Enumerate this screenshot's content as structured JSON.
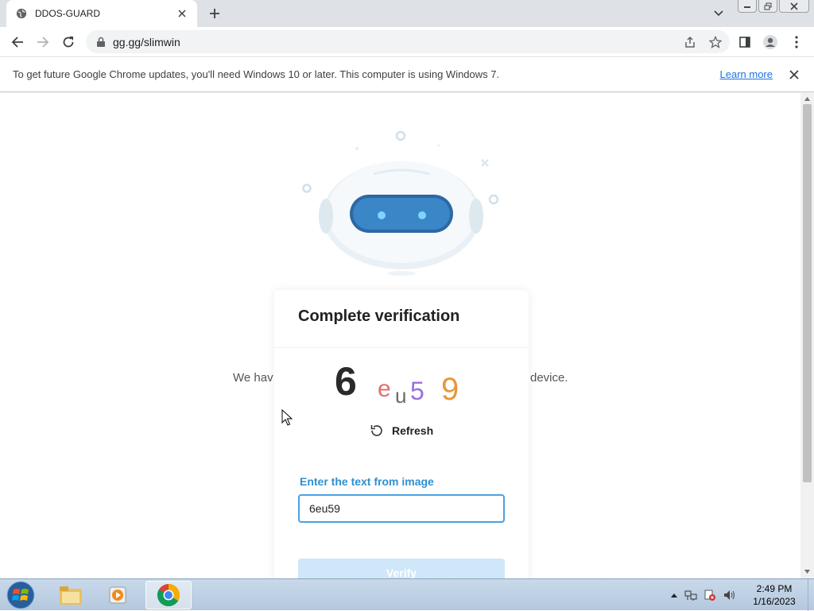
{
  "browser": {
    "tab_title": "DDOS-GUARD",
    "url": "gg.gg/slimwin",
    "infobar_message": "To get future Google Chrome updates, you'll need Windows 10 or later. This computer is using Windows 7.",
    "infobar_link": "Learn more"
  },
  "page": {
    "background_text_left": "We hav",
    "background_text_right": "device.",
    "card": {
      "heading": "Complete verification",
      "captcha_text": "6eu59",
      "refresh_label": "Refresh",
      "field_label": "Enter the text from image",
      "field_value": "6eu59",
      "verify_label": "Verify"
    }
  },
  "taskbar": {
    "time": "2:49 PM",
    "date": "1/16/2023"
  },
  "colors": {
    "accent_blue": "#2f8fcf",
    "input_border": "#4aa1e0",
    "verify_disabled": "#cfe7f8",
    "link": "#1a73e8"
  }
}
